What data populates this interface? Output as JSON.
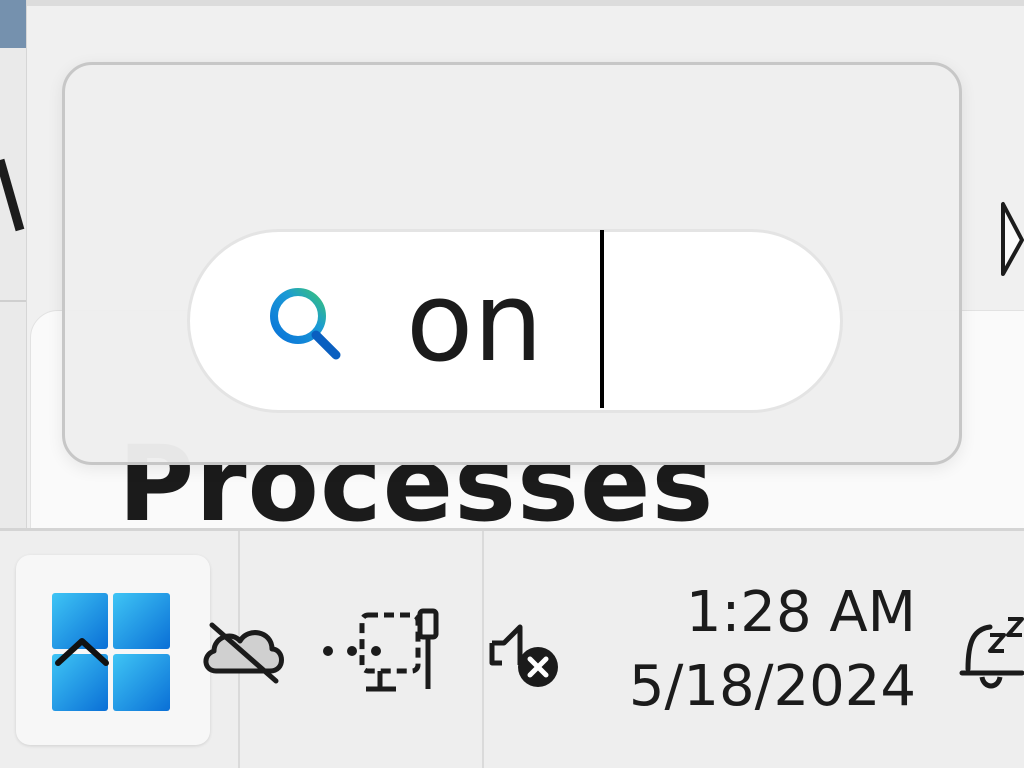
{
  "background_window": {
    "page_title": "Processes"
  },
  "search": {
    "query": "on",
    "icon": "search-icon"
  },
  "taskbar": {
    "start_icon": "windows-start-icon",
    "overflow_icon": "chevron-up-icon",
    "tray_icons": [
      "onedrive-offline-icon",
      "network-ethernet-icon",
      "volume-muted-icon",
      "notification-snooze-icon"
    ],
    "clock": {
      "time": "1:28 AM",
      "date": "5/18/2024"
    }
  },
  "colors": {
    "accent_blue": "#0a73d9",
    "search_green": "#39c27a",
    "taskbar_bg": "#eeeeee",
    "popup_bg": "#eeeeee"
  }
}
